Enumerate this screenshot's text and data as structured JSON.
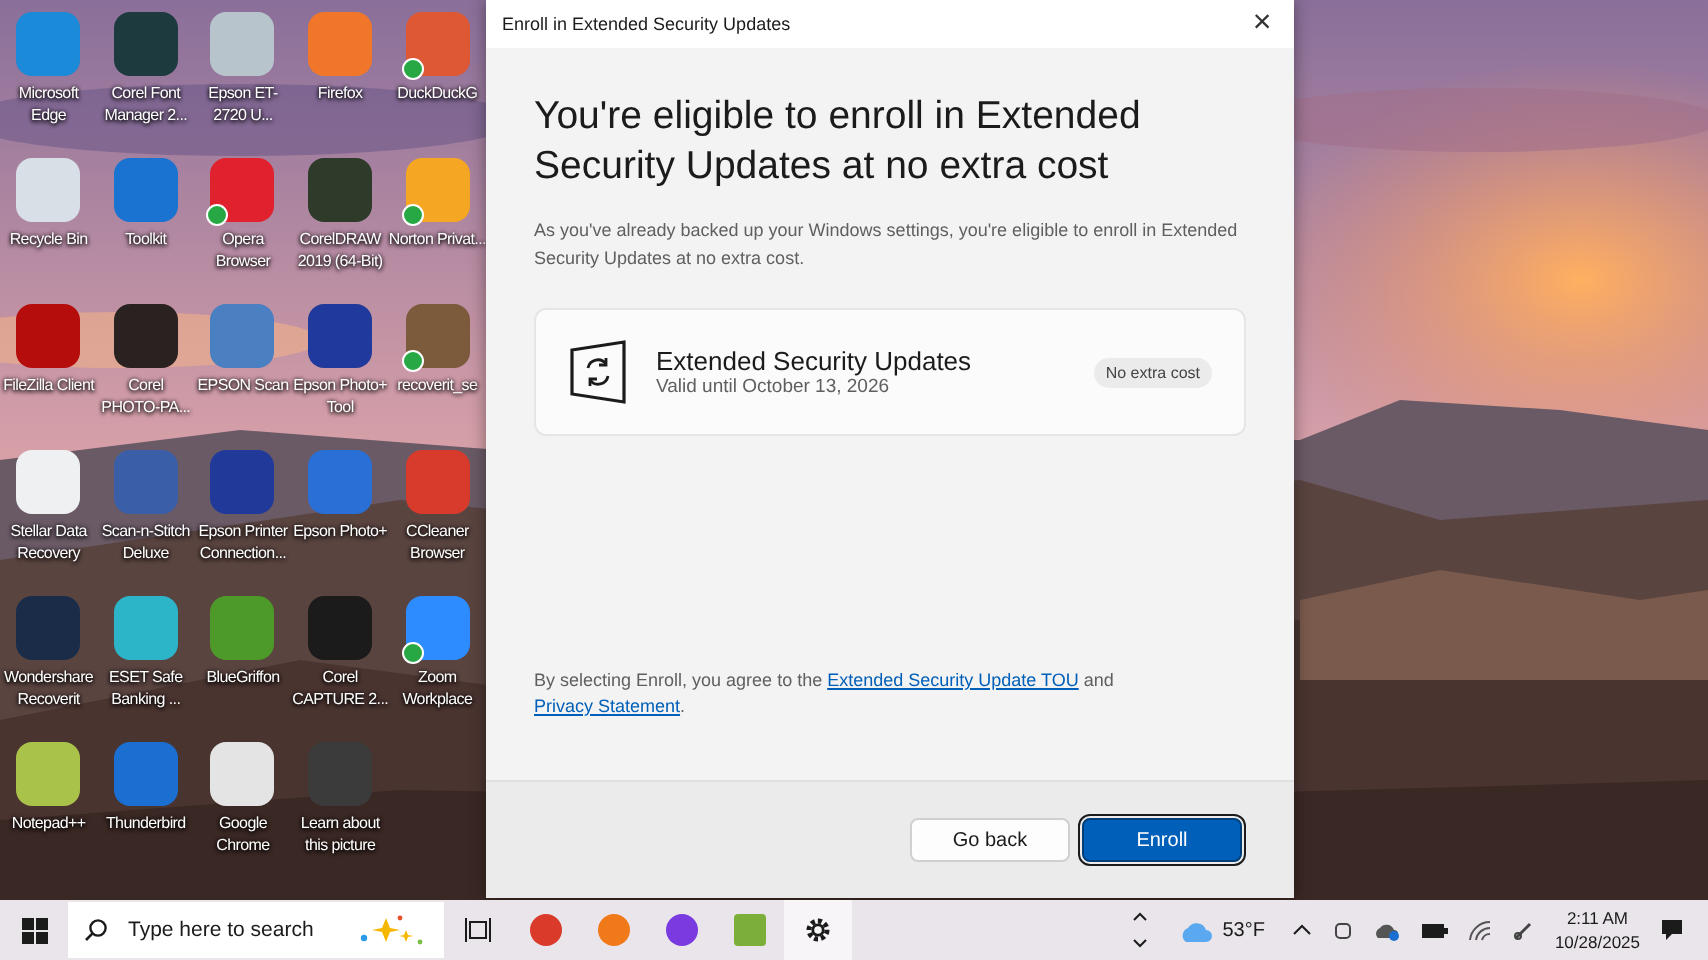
{
  "desktop_icons": [
    {
      "label": "Microsoft Edge",
      "synced": false
    },
    {
      "label": "Corel Font Manager 2...",
      "synced": false
    },
    {
      "label": "Epson ET-2720 U...",
      "synced": false
    },
    {
      "label": "Firefox",
      "synced": false
    },
    {
      "label": "DuckDuckG",
      "synced": true
    },
    {
      "label": "Recycle Bin",
      "synced": false
    },
    {
      "label": "Toolkit",
      "synced": false
    },
    {
      "label": "Opera Browser",
      "synced": true
    },
    {
      "label": "CorelDRAW 2019 (64-Bit)",
      "synced": false
    },
    {
      "label": "Norton Privat...",
      "synced": true
    },
    {
      "label": "FileZilla Client",
      "synced": false
    },
    {
      "label": "Corel PHOTO-PA...",
      "synced": false
    },
    {
      "label": "EPSON Scan",
      "synced": false
    },
    {
      "label": "Epson Photo+ Tool",
      "synced": false
    },
    {
      "label": "recoverit_se",
      "synced": true
    },
    {
      "label": "Stellar Data Recovery",
      "synced": false
    },
    {
      "label": "Scan-n-Stitch Deluxe",
      "synced": false
    },
    {
      "label": "Epson Printer Connection...",
      "synced": false
    },
    {
      "label": "Epson Photo+",
      "synced": false
    },
    {
      "label": "CCleaner Browser",
      "synced": false
    },
    {
      "label": "Wondershare Recoverit",
      "synced": false
    },
    {
      "label": "ESET Safe Banking ...",
      "synced": false
    },
    {
      "label": "BlueGriffon",
      "synced": false
    },
    {
      "label": "Corel CAPTURE 2...",
      "synced": false
    },
    {
      "label": "Zoom Workplace",
      "synced": true
    },
    {
      "label": "Notepad++",
      "synced": false
    },
    {
      "label": "Thunderbird",
      "synced": false
    },
    {
      "label": "Google Chrome",
      "synced": false
    },
    {
      "label": "Learn about this picture",
      "synced": false
    }
  ],
  "dialog": {
    "title": "Enroll in Extended Security Updates",
    "close": "×",
    "heading": "You're eligible to enroll in Extended Security Updates at no extra cost",
    "description": "As you've already backed up your Windows settings, you're eligible to enroll in Extended Security Updates at no extra cost.",
    "offer": {
      "title": "Extended Security Updates",
      "subtitle": "Valid until October 13, 2026",
      "badge": "No extra cost"
    },
    "agreement": {
      "before": "By selecting Enroll, you agree to the ",
      "link_1": "Extended Security Update TOU",
      "middle": " and ",
      "link_2": "Privacy Statement",
      "after": "."
    },
    "buttons": [
      {
        "label": "Go back",
        "kind": "secondary"
      },
      {
        "label": "Enroll",
        "kind": "primary"
      }
    ]
  },
  "taskbar": {
    "search": {
      "placeholder": "Type here to search"
    },
    "apps": [
      {
        "selected": false
      },
      {
        "selected": false
      },
      {
        "selected": false
      },
      {
        "selected": false
      },
      {
        "selected": true
      }
    ],
    "weather": "53°F",
    "time": "2:11 AM",
    "date": "10/28/2025"
  }
}
